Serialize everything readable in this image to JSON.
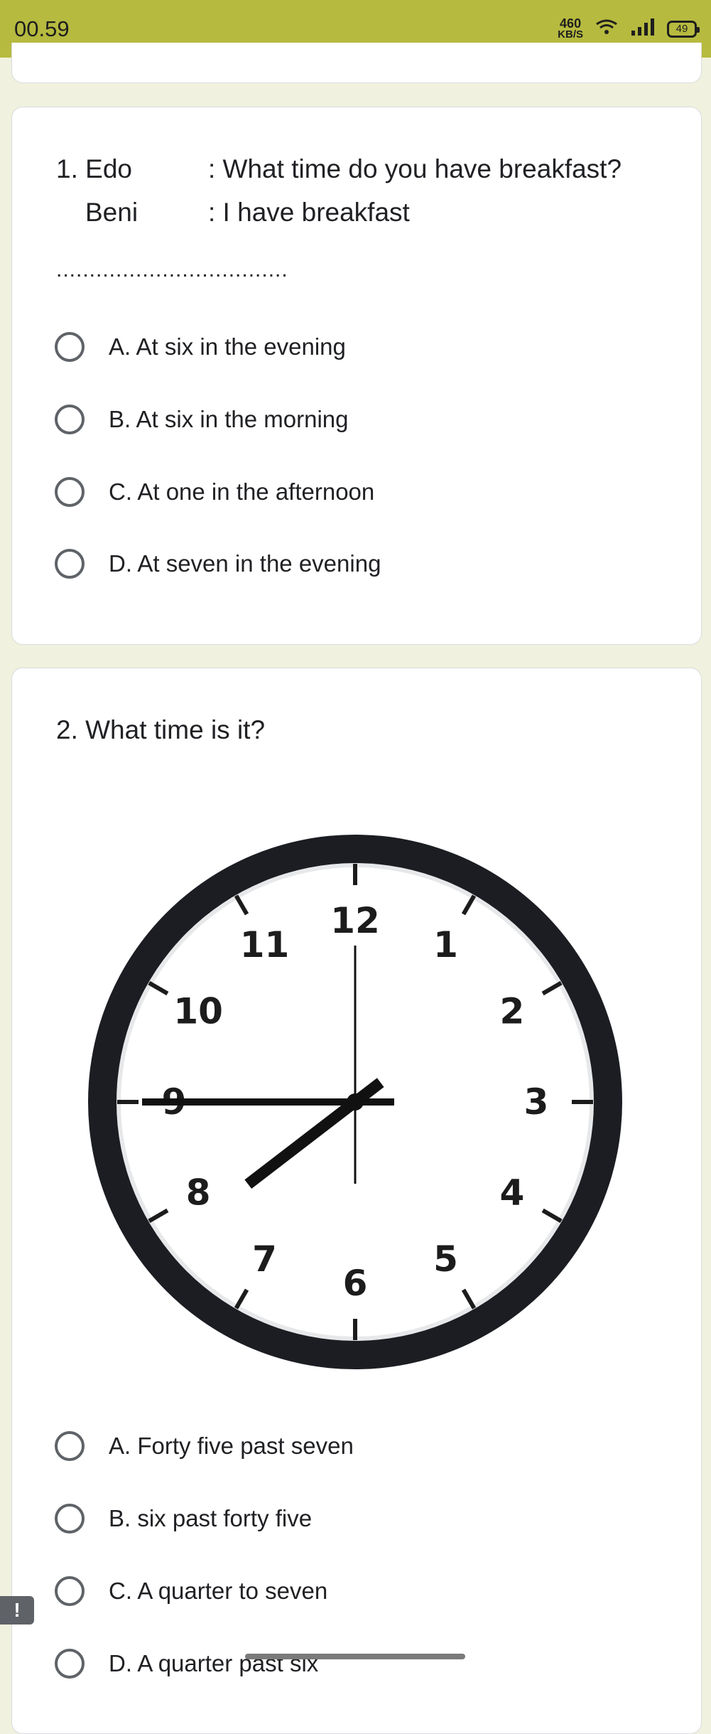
{
  "status_bar": {
    "time": "00.59",
    "net_speed_value": "460",
    "net_speed_unit": "KB/S",
    "battery": "49"
  },
  "q1": {
    "line1_speaker": "1. Edo",
    "line1_text": ": What time do you have breakfast?",
    "line2_speaker": "Beni",
    "line2_text": ":   I have breakfast",
    "blank": "...................................",
    "options": [
      "A. At six in the evening",
      "B. At six in the morning",
      "C. At one in the afternoon",
      "D. At seven in the evening"
    ]
  },
  "q2": {
    "question": "2. What time is it?",
    "clock_numbers": [
      "12",
      "1",
      "2",
      "3",
      "4",
      "5",
      "6",
      "7",
      "8",
      "9",
      "10",
      "11"
    ],
    "clock_time": {
      "hour": 7,
      "minute": 45
    },
    "options": [
      "A. Forty five past seven",
      "B. six past forty five",
      "C. A quarter to seven",
      "D. A quarter past six"
    ]
  },
  "colors": {
    "status_bar": "#b6ba3f",
    "background": "#f0f1de",
    "card": "#ffffff"
  }
}
